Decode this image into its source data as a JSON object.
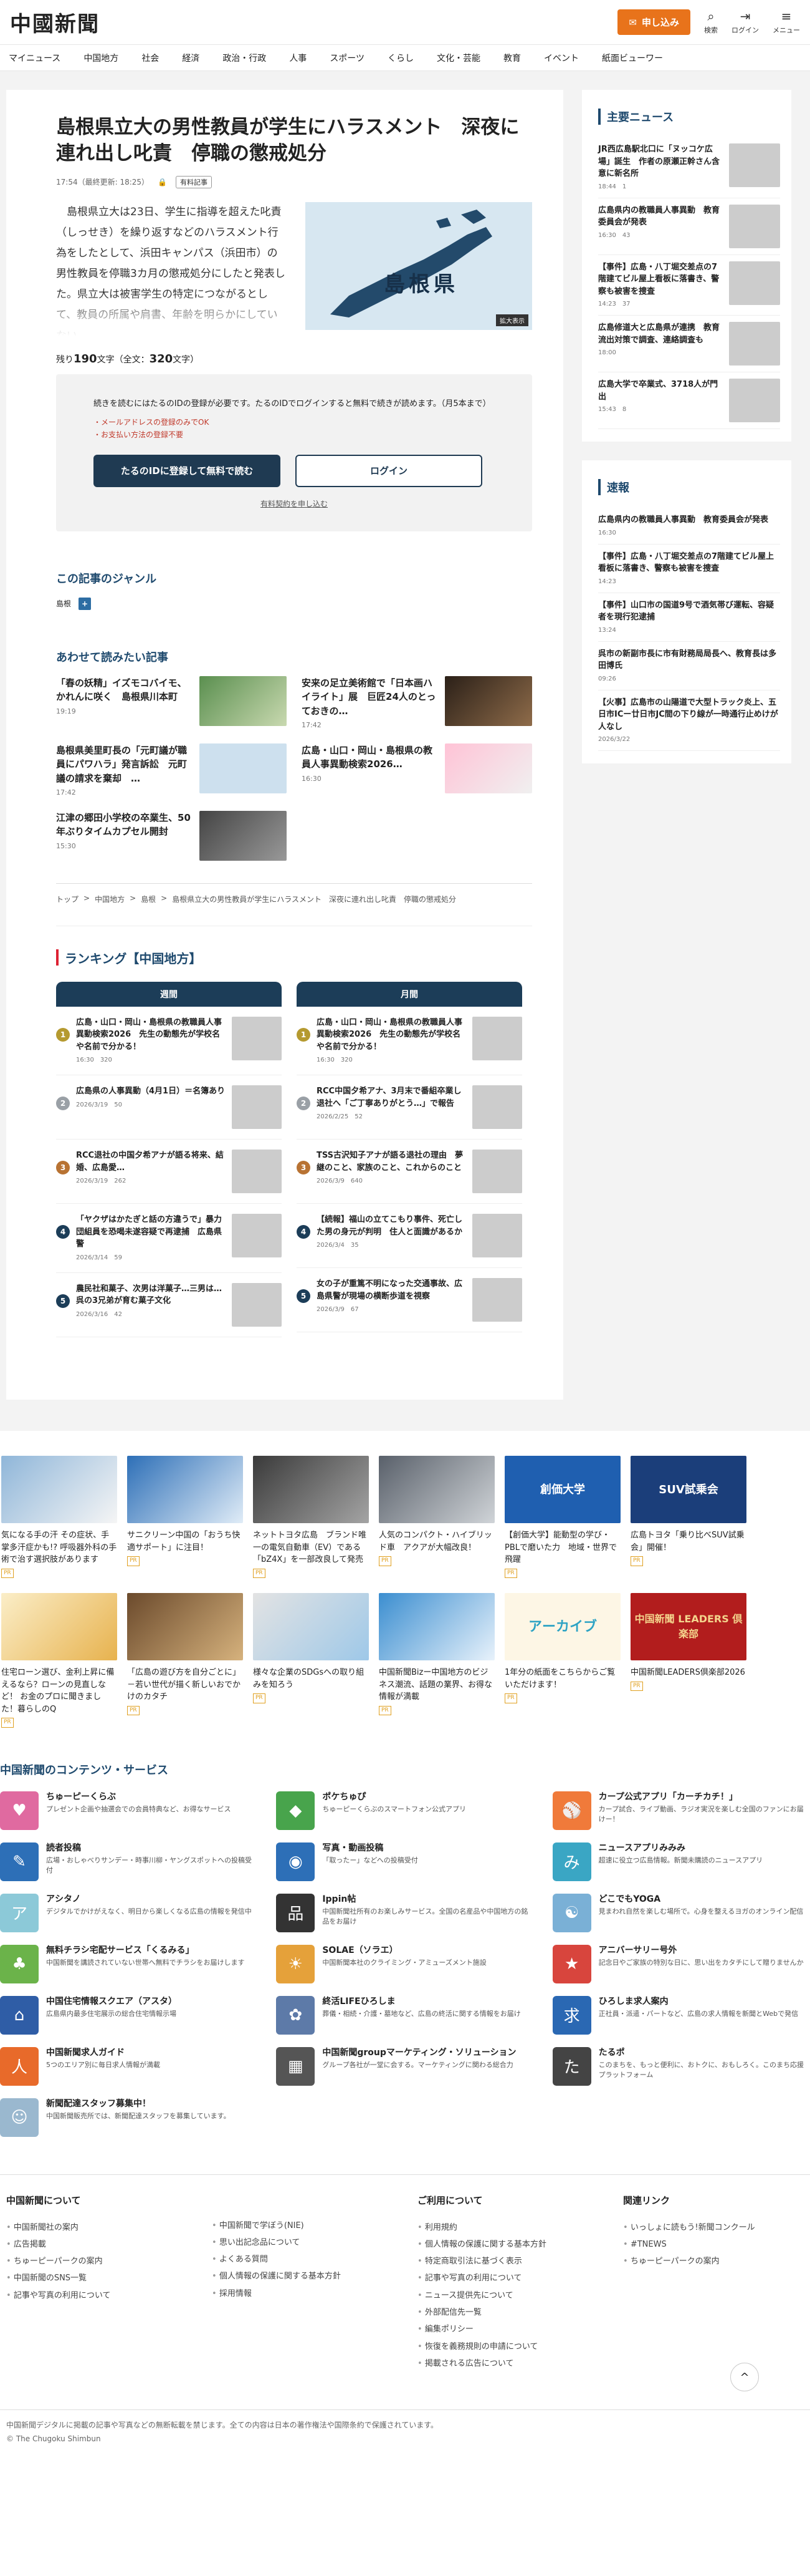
{
  "header": {
    "logo": "中國新聞",
    "subscribe": "申し込み",
    "search": "検索",
    "login": "ログイン",
    "menu": "メニュー"
  },
  "nav": [
    "マイニュース",
    "中国地方",
    "社会",
    "経済",
    "政治・行政",
    "人事",
    "スポーツ",
    "くらし",
    "文化・芸能",
    "教育",
    "イベント",
    "紙面ビューワー"
  ],
  "article": {
    "headline": "島根県立大の男性教員が学生にハラスメント　深夜に連れ出し叱責　停職の懲戒処分",
    "time": "17:54（最終更新: 18:25）",
    "badge": "有料記事",
    "lead": "島根県立大は23日、学生に指導を超えた叱責（しっせき）を繰り返すなどのハラスメント行為をしたとして、浜田キャンパス（浜田市）の男性教員を停職3カ月の懲戒処分にしたと発表した。県立大は被害学生の特定につながるとして、教員の所属や肩書、年齢を明らかにしていない。",
    "map_label": "島根県",
    "map_zoom": "拡大表示",
    "remaining_pre": "残り",
    "remaining": "190",
    "remaining_post": "文字（全文：",
    "total": "320",
    "total_post": "文字）"
  },
  "gate": {
    "msg": "続きを読むにはたるのIDの登録が必要です。たるのIDでログインすると無料で続きが読めます。（月5本まで）",
    "notes": [
      "・メールアドレスの登録のみでOK",
      "・お支払い方法の登録不要"
    ],
    "register": "たるのIDに登録して無料で読む",
    "login": "ログイン",
    "paid": "有料契約を申し込む"
  },
  "genre": {
    "title": "この記事のジャンル",
    "tag": "島根",
    "add": "+"
  },
  "related": {
    "title": "あわせて読みたい記事",
    "items": [
      {
        "title": "「春の妖精」イズモコバイモ、かれんに咲く　島根県川本町",
        "time": "19:19"
      },
      {
        "title": "安来の足立美術館で「日本画ハイライト」展　巨匠24人のとっておきの…",
        "time": "17:42"
      },
      {
        "title": "島根県美里町長の「元町議が職員にパワハラ」発言訴訟　元町議の請求を棄却　…",
        "time": "17:42"
      },
      {
        "title": "広島・山口・岡山・島根県の教員人事異動検索2026…",
        "time": "16:30"
      },
      {
        "title": "江津の郷田小学校の卒業生、50年ぶりタイムカプセル開封",
        "time": "15:30"
      }
    ]
  },
  "breadcrumb": [
    "トップ",
    "中国地方",
    "島根",
    "島根県立大の男性教員が学生にハラスメント　深夜に連れ出し叱責　停職の懲戒処分"
  ],
  "ranking": {
    "title": "ランキング【中国地方】",
    "weekly_label": "週間",
    "monthly_label": "月間",
    "weekly": [
      {
        "rank": "1",
        "title": "広島・山口・岡山・島根県の教職員人事異動検索2026　先生の動態先が学校名や名前で分かる！",
        "meta": "16:30　320"
      },
      {
        "rank": "2",
        "title": "広島県の人事異動（4月1日）＝名簿あり",
        "meta": "2026/3/19　50"
      },
      {
        "rank": "3",
        "title": "RCC退社の中国夕希アナが語る将来、結婚、広島愛…",
        "meta": "2026/3/19　262"
      },
      {
        "rank": "4",
        "title": "「ヤクザはかたぎと話の方違うで」暴力団組員を恐喝未遂容疑で再逮捕　広島県警",
        "meta": "2026/3/14　59"
      },
      {
        "rank": "5",
        "title": "農民社和菓子、次男は洋菓子…三男は…呉の3兄弟が育む菓子文化",
        "meta": "2026/3/16　42"
      }
    ],
    "monthly": [
      {
        "rank": "1",
        "title": "広島・山口・岡山・島根県の教職員人事異動検索2026　先生の動態先が学校名や名前で分かる！",
        "meta": "16:30　320"
      },
      {
        "rank": "2",
        "title": "RCC中国夕希アナ、3月末で番組卒業し退社へ「ご丁寧ありがとう…」で報告",
        "meta": "2026/2/25　52"
      },
      {
        "rank": "3",
        "title": "TSS古沢知子アナが語る退社の理由　夢継のこと、家族のこと、これからのこと",
        "meta": "2026/3/9　640"
      },
      {
        "rank": "4",
        "title": "【続報】福山の立てこもり事件、死亡した男の身元が判明　住人と面識があるか",
        "meta": "2026/3/4　35"
      },
      {
        "rank": "5",
        "title": "女の子が重篤不明になった交通事故、広島県警が現場の横断歩道を視察",
        "meta": "2026/3/9　67"
      }
    ]
  },
  "sidebar": {
    "main_title": "主要ニュース",
    "main": [
      {
        "title": "JR西広島駅北口に「ヌッコケ広場」誕生　作者の原瀬正幹さん含意に新名所",
        "meta": "18:44　1"
      },
      {
        "title": "広島県内の教職員人事異動　教育委員会が発表",
        "meta": "16:30　43"
      },
      {
        "title": "【事件】広島・八丁堀交差点の7階建てビル屋上看板に落書き、警察も被害を捜査",
        "meta": "14:23　37"
      },
      {
        "title": "広島修道大と広島県が連携　教育流出対策で調査、連絡調査も",
        "meta": "18:00"
      },
      {
        "title": "広島大学で卒業式、3718人が門出",
        "meta": "15:43　8"
      }
    ],
    "flash_title": "速報",
    "flash": [
      {
        "title": "広島県内の教職員人事異動　教育委員会が発表",
        "time": "16:30"
      },
      {
        "title": "【事件】広島・八丁堀交差点の7階建てビル屋上看板に落書き、警察も被害を捜査",
        "time": "14:23"
      },
      {
        "title": "【事件】山口市の国道9号で酒気帯び運転、容疑者を現行犯逮捕",
        "time": "13:24"
      },
      {
        "title": "呉市の新副市長に市有財務局局長へ、教育長は多田博氏",
        "time": "09:26"
      },
      {
        "title": "【火事】広島市の山陽道で大型トラック炎上、五日市ICー廿日市JC間の下り線が一時通行止めけが人なし",
        "time": "2026/3/22"
      }
    ]
  },
  "promos": [
    {
      "title": "気になる手の汗 その症状、手掌多汗症かも!? 呼吸器外科の手術で治す選択肢があります",
      "pr": "PR"
    },
    {
      "title": "サニクリーン中国の「おうち快適サポート」に注目！",
      "pr": "PR"
    },
    {
      "title": "ネットトヨタ広島　ブランド唯一の電気自動車（EV）である「bZ4X」を一部改良して発売",
      "pr": "PR"
    },
    {
      "title": "人気のコンパクト・ハイブリッド車　アクアが大幅改良！",
      "pr": "PR"
    },
    {
      "title": "【創価大学】能動型の学び・PBLで磨いた力　地域・世界で飛躍",
      "pr": "PR"
    },
    {
      "title": "広島トヨタ「乗り比べSUV試乗会」開催！",
      "pr": "PR"
    },
    {
      "title": "住宅ローン選び、金利上昇に備えるなら？ローンの見直しなど！ お金のプロに聞きました！暮らしのQ",
      "pr": "PR"
    },
    {
      "title": "「広島の遊び方を自分ごとに」－若い世代が描く新しいおでかけのカタチ",
      "pr": "PR"
    },
    {
      "title": "様々な企業のSDGsへの取り組みを知ろう",
      "pr": "PR"
    },
    {
      "title": "中国新聞Bizー中国地方のビジネス潮流、話題の業界、お得な情報が満載",
      "pr": "PR"
    },
    {
      "title": "1年分の紙面をこちらからご覧いただけます！",
      "pr": "PR"
    },
    {
      "title": "中国新聞LEADERS倶楽部2026",
      "pr": "PR"
    }
  ],
  "promo_art": {
    "p5": "創価大学",
    "p6": "SUV試乗会",
    "p11": "アーカイブ",
    "p12": "中国新聞 LEADERS 倶楽部"
  },
  "services": {
    "title": "中国新聞のコンテンツ・サービス",
    "items": [
      {
        "name": "ちゅーピーくらぶ",
        "desc": "プレゼント企画や抽選会での会員特典など、お得なサービス"
      },
      {
        "name": "ポケちゅぴ",
        "desc": "ちゅーピーくらぶのスマートフォン公式アプリ"
      },
      {
        "name": "カープ公式アプリ「カーチカチ！」",
        "desc": "カープ試合、ライブ動画、ラジオ実況を楽しむ全国のファンにお届けー！"
      },
      {
        "name": "読者投稿",
        "desc": "広場・おしゃべりサンデー・時事川柳・ヤングスポットへの投稿受付"
      },
      {
        "name": "写真・動画投稿",
        "desc": "「取ったー」などへの投稿受付"
      },
      {
        "name": "ニュースアプリみみみ",
        "desc": "超速に役立つ広島情報。新聞未購読のニュースアプリ"
      },
      {
        "name": "アシタノ",
        "desc": "デジタルでかけがえなく、明日から楽しくなる広島の情報を発信中"
      },
      {
        "name": "Ippin帖",
        "desc": "中国新聞社所有のお楽しみサービス。全国の名産品や中国地方の銘品をお届け"
      },
      {
        "name": "どこでもYOGA",
        "desc": "見まわれ自然を楽しむ場所で。心身を整えるヨガのオンライン配信"
      },
      {
        "name": "無料チラシ宅配サービス「くるみる」",
        "desc": "中国新聞を講読されていない世帯へ無料でチラシをお届けします"
      },
      {
        "name": "SOLAE（ソラエ）",
        "desc": "中国新聞本社のクライミング・アミューズメント施設"
      },
      {
        "name": "アニバーサリー号外",
        "desc": "記念日やご家族の特別な日に、思い出をカタチにして贈りませんか"
      },
      {
        "name": "中国住宅情報スクエア（アスタ）",
        "desc": "広島県内最多住宅展示の総合住宅情報示場"
      },
      {
        "name": "終活LIFEひろしま",
        "desc": "葬儀・相続・介護・墓地など、広島の終活に関する情報をお届け"
      },
      {
        "name": "ひろしま求人案内",
        "desc": "正社員・派遣・パートなど、広島の求人情報を新聞とWebで発信"
      },
      {
        "name": "中国新聞求人ガイド",
        "desc": "5つのエリア別に毎日求人情報が満載"
      },
      {
        "name": "中国新聞groupマーケティング・ソリューション",
        "desc": "グループ各社が一堂に会する。マーケティングに関わる総合力"
      },
      {
        "name": "たるポ",
        "desc": "このまちを、もっと便利に、おトクに、おもしろく。このまち応援プラットフォーム"
      },
      {
        "name": "新聞配達スタッフ募集中！",
        "desc": "中国新聞販売所では、新聞配達スタッフを募集しています。"
      }
    ]
  },
  "footer": {
    "col1_title": "中国新聞について",
    "col1": [
      "中国新聞社の案内",
      "広告掲載",
      "ちゅーピーパークの案内",
      "中国新聞のSNS一覧",
      "記事や写真の利用について"
    ],
    "col2": [
      "中国新聞で学ぼう(NIE)",
      "思い出記念品について",
      "よくある質問",
      "個人情報の保護に関する基本方針",
      "採用情報"
    ],
    "col3_title": "ご利用について",
    "col3": [
      "利用規約",
      "個人情報の保護に関する基本方針",
      "特定商取引法に基づく表示",
      "記事や写真の利用について",
      "ニュース提供先について",
      "外部配信先一覧",
      "編集ポリシー",
      "恢復を義務規則の申請について",
      "掲載される広告について"
    ],
    "col4_title": "関連リンク",
    "col4": [
      "いっしょに読もう!新聞コンクール",
      "#TNEWS",
      "ちゅーピーパークの案内"
    ],
    "notice": "中国新聞デジタルに掲載の記事や写真などの無断転載を禁じます。全ての内容は日本の著作権法や国際条約で保護されています。",
    "copyright": "© The Chugoku Shimbun",
    "to_top": "^"
  },
  "colors": {
    "accent": "#e8731b",
    "navy": "#1f3a52",
    "brand_blue": "#1f4a6e"
  }
}
